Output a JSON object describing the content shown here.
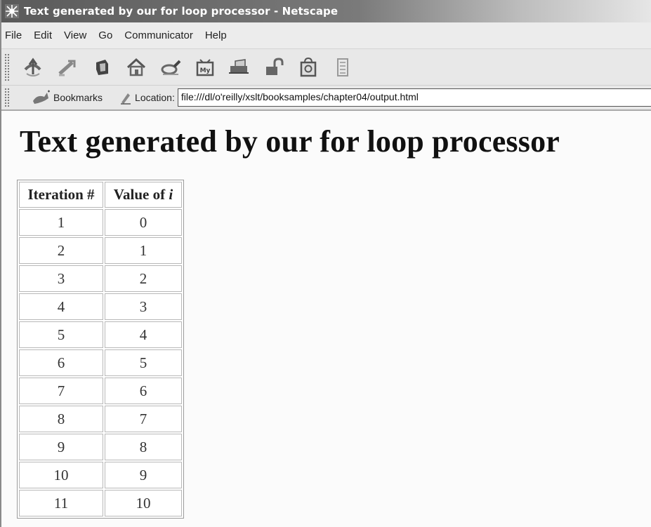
{
  "window": {
    "title": "Text generated by our for loop processor - Netscape"
  },
  "menu": {
    "items": [
      "File",
      "Edit",
      "View",
      "Go",
      "Communicator",
      "Help"
    ]
  },
  "toolbar": {
    "buttons": [
      "back-icon",
      "forward-icon",
      "reload-icon",
      "home-icon",
      "search-icon",
      "my-netscape-icon",
      "print-icon",
      "security-icon",
      "shop-icon",
      "stop-icon"
    ]
  },
  "location_bar": {
    "bookmarks_label": "Bookmarks",
    "location_label": "Location:",
    "url": "file:///dl/o'reilly/xslt/booksamples/chapter04/output.html"
  },
  "page": {
    "heading": "Text generated by our for loop processor",
    "table": {
      "header_iteration": "Iteration #",
      "header_value_prefix": "Value of ",
      "header_value_var": "i",
      "rows": [
        [
          "1",
          "0"
        ],
        [
          "2",
          "1"
        ],
        [
          "3",
          "2"
        ],
        [
          "4",
          "3"
        ],
        [
          "5",
          "4"
        ],
        [
          "6",
          "5"
        ],
        [
          "7",
          "6"
        ],
        [
          "8",
          "7"
        ],
        [
          "9",
          "8"
        ],
        [
          "10",
          "9"
        ],
        [
          "11",
          "10"
        ]
      ]
    }
  }
}
